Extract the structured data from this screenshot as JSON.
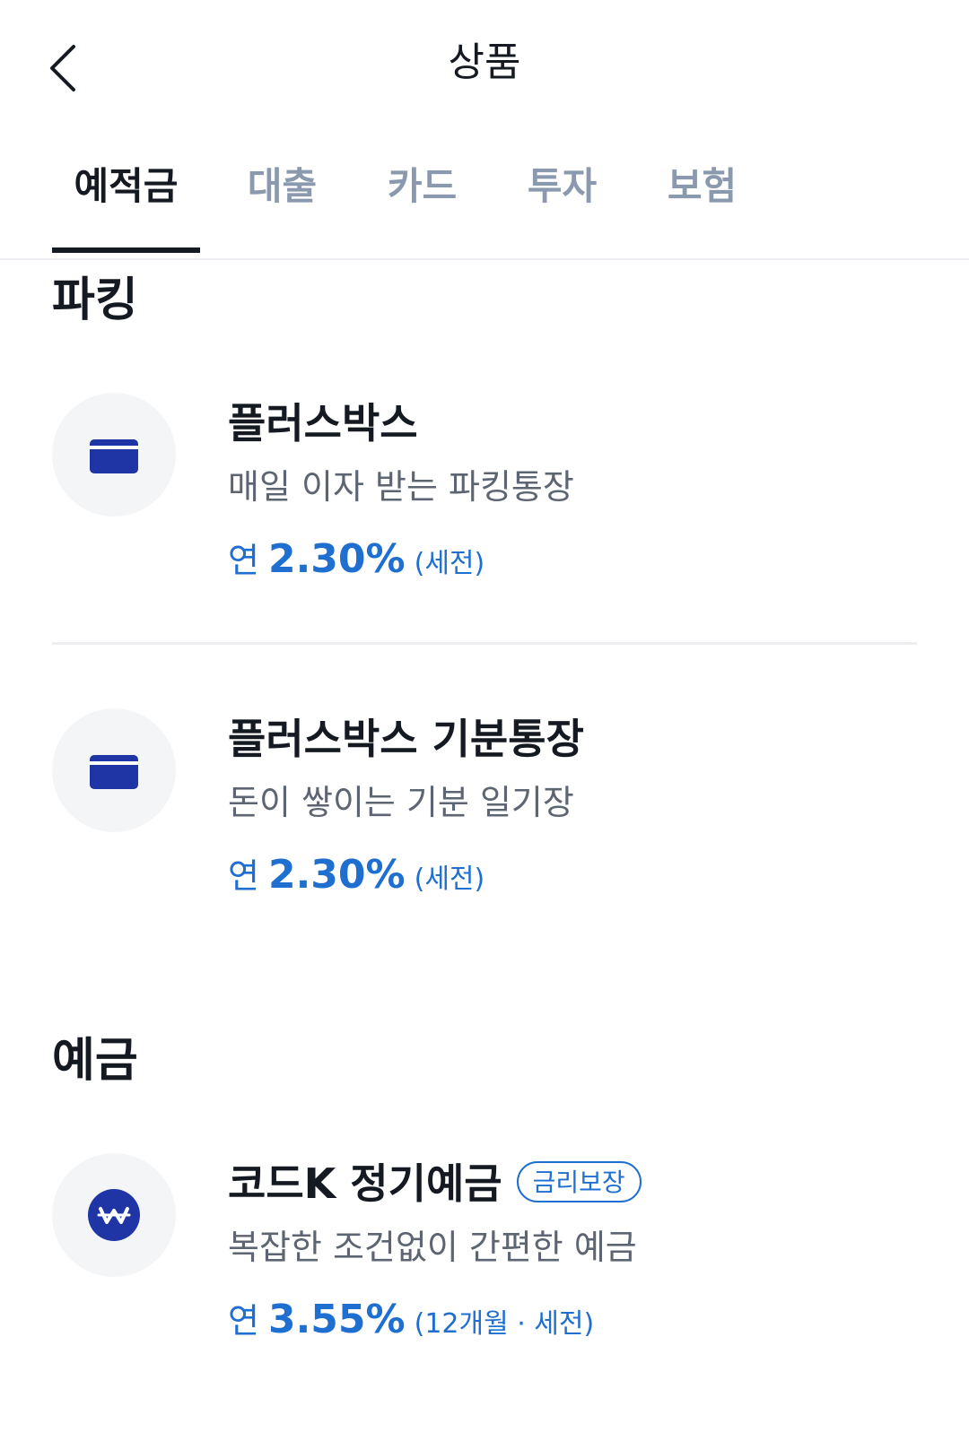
{
  "header": {
    "title": "상품"
  },
  "tabs": [
    {
      "label": "예적금",
      "active": true
    },
    {
      "label": "대출",
      "active": false
    },
    {
      "label": "카드",
      "active": false
    },
    {
      "label": "투자",
      "active": false
    },
    {
      "label": "보험",
      "active": false
    }
  ],
  "sections": [
    {
      "title": "파킹",
      "products": [
        {
          "name": "플러스박스",
          "description": "매일 이자 받는 파킹통장",
          "rate_prefix": "연",
          "rate": "2.30%",
          "rate_note": "(세전)",
          "icon": "card-icon"
        },
        {
          "name": "플러스박스 기분통장",
          "description": "돈이 쌓이는 기분 일기장",
          "rate_prefix": "연",
          "rate": "2.30%",
          "rate_note": "(세전)",
          "icon": "card-icon"
        }
      ]
    },
    {
      "title": "예금",
      "products": [
        {
          "name": "코드K 정기예금",
          "badge": "금리보장",
          "description": "복잡한 조건없이 간편한 예금",
          "rate_prefix": "연",
          "rate": "3.55%",
          "rate_note": "(12개월 · 세전)",
          "icon": "won-coin-icon"
        }
      ]
    }
  ],
  "colors": {
    "accent_blue": "#1f6fd1",
    "icon_navy": "#1f35a6",
    "text_primary": "#151a22",
    "text_secondary": "#5c6571",
    "tab_inactive": "#8a99ad"
  }
}
